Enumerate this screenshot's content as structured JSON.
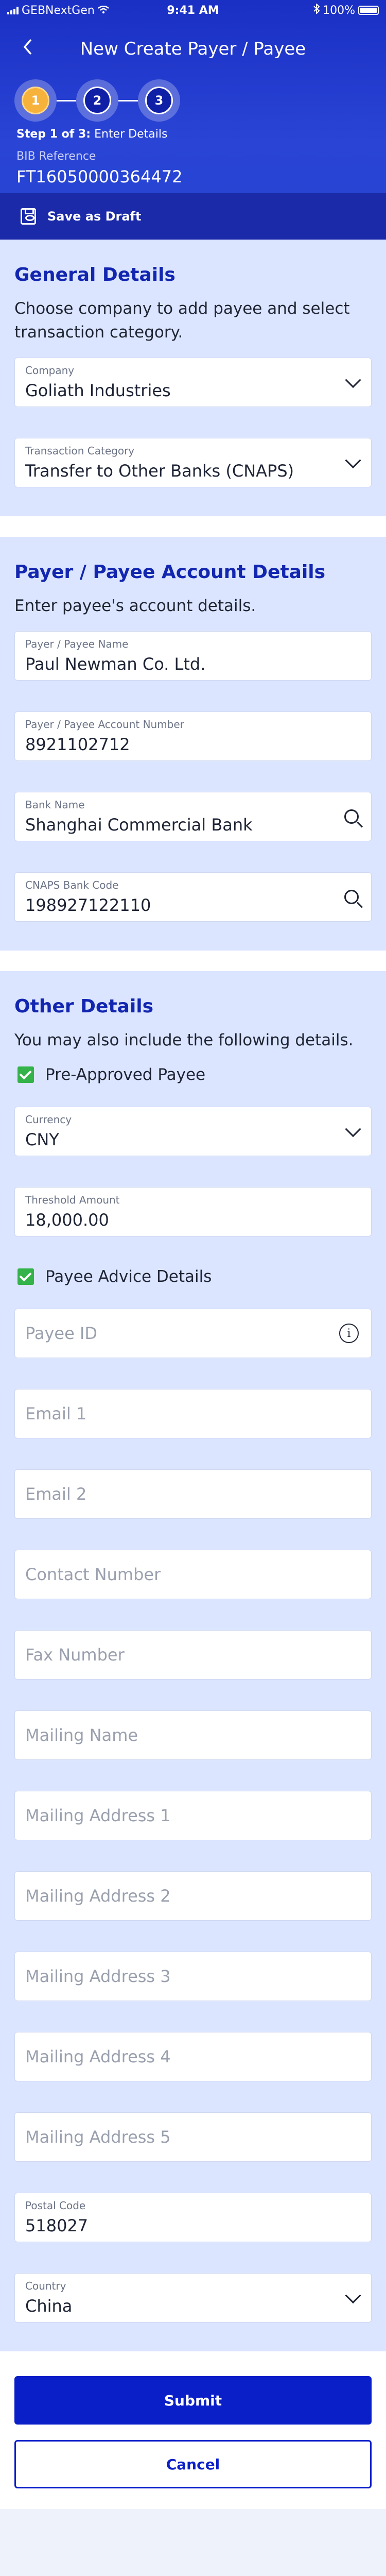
{
  "status_bar": {
    "carrier": "GEBNextGen",
    "time": "9:41 AM",
    "battery": "100%"
  },
  "header": {
    "title": "New Create Payer / Payee",
    "steps": [
      "1",
      "2",
      "3"
    ],
    "step_prefix": "Step 1 of 3:",
    "step_text": "Enter Details",
    "bib_label": "BIB Reference",
    "bib_value": "FT16050000364472",
    "save_draft": "Save as Draft"
  },
  "general": {
    "title": "General Details",
    "desc": "Choose company to add payee and select transaction category.",
    "company_label": "Company",
    "company_value": "Goliath Industries",
    "category_label": "Transaction Category",
    "category_value": "Transfer to Other Banks (CNAPS)"
  },
  "account": {
    "title": "Payer / Payee Account Details",
    "desc": "Enter payee's account details.",
    "name_label": "Payer / Payee Name",
    "name_value": "Paul Newman Co. Ltd.",
    "number_label": "Payer / Payee Account Number",
    "number_value": "8921102712",
    "bank_label": "Bank Name",
    "bank_value": "Shanghai Commercial Bank",
    "cnaps_label": "CNAPS Bank Code",
    "cnaps_value": "198927122110"
  },
  "other": {
    "title": "Other Details",
    "desc": "You may also include the following details.",
    "pre_approved": "Pre-Approved Payee",
    "currency_label": "Currency",
    "currency_value": "CNY",
    "threshold_label": "Threshold Amount",
    "threshold_value": "18,000.00",
    "advice": "Payee Advice Details",
    "payee_id": "Payee ID",
    "email1": "Email 1",
    "email2": "Email 2",
    "contact": "Contact Number",
    "fax": "Fax Number",
    "mailing_name": "Mailing Name",
    "addr1": "Mailing Address 1",
    "addr2": "Mailing Address 2",
    "addr3": "Mailing Address 3",
    "addr4": "Mailing Address 4",
    "addr5": "Mailing Address 5",
    "postal_label": "Postal Code",
    "postal_value": "518027",
    "country_label": "Country",
    "country_value": "China"
  },
  "footer": {
    "submit": "Submit",
    "cancel": "Cancel"
  },
  "colors": {
    "primary": "#0b1fc9",
    "header": "#2442d0",
    "section_bg": "#dbe5ff",
    "check": "#34b34a",
    "step_active": "#f7b23b"
  }
}
